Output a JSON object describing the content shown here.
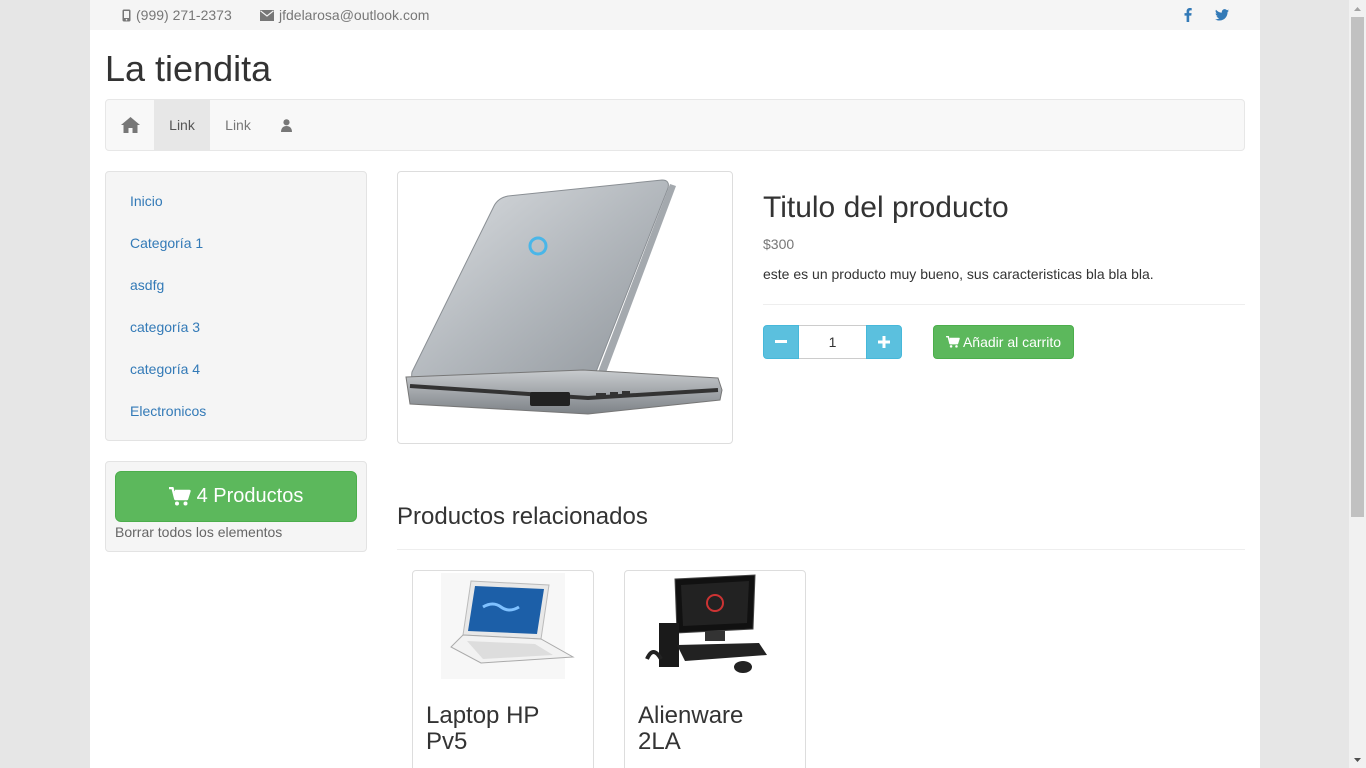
{
  "topbar": {
    "phone": "(999) 271-2373",
    "email": "jfdelarosa@outlook.com",
    "social_icons": [
      "facebook-icon",
      "twitter-icon"
    ]
  },
  "brand": "La tiendita",
  "navbar": {
    "home_icon": "home-icon",
    "link1": "Link",
    "link2": "Link",
    "user_icon": "user-icon"
  },
  "sidebar": {
    "items": [
      "Inicio",
      "Categoría 1",
      "asdfg",
      "categoría 3",
      "categoría 4",
      "Electronicos"
    ]
  },
  "cart": {
    "button_label": "4 Productos",
    "clear_label": "Borrar todos los elementos"
  },
  "product": {
    "title": "Titulo del producto",
    "price": "$300",
    "description": "este es un producto muy bueno, sus caracteristicas bla bla bla.",
    "quantity": "1",
    "add_to_cart": "Añadir al carrito"
  },
  "related": {
    "title": "Productos relacionados",
    "items": [
      {
        "name": "Laptop HP Pv5"
      },
      {
        "name": "Alienware 2LA"
      }
    ]
  },
  "colors": {
    "success": "#5cb85c",
    "info": "#5bc0de",
    "link": "#337ab7"
  }
}
